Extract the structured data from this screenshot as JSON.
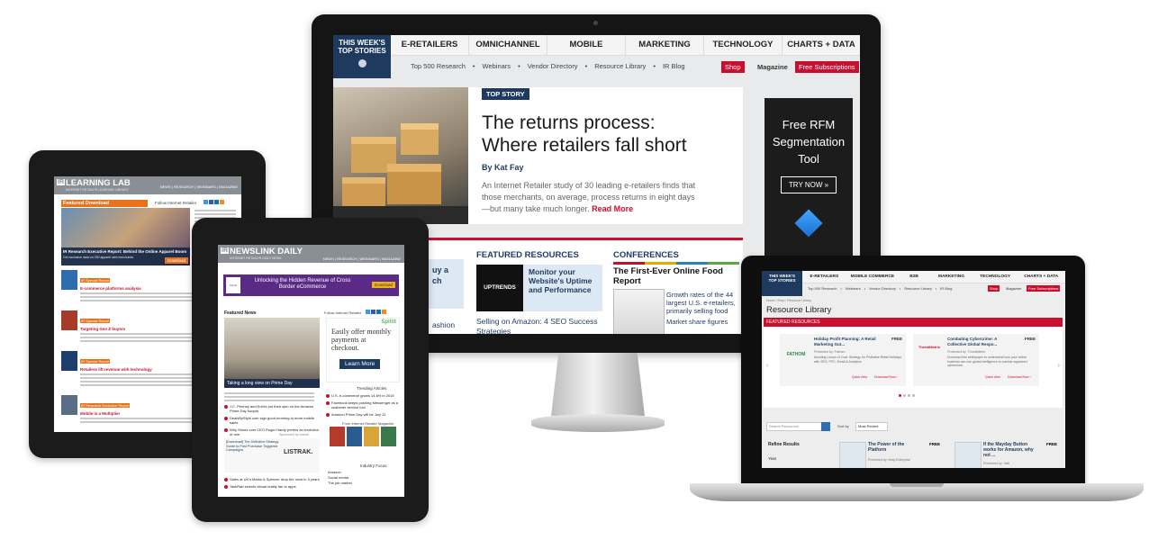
{
  "monitor": {
    "badge_line1": "THIS WEEK'S",
    "badge_line2": "TOP STORIES",
    "nav": [
      "E-RETAILERS",
      "OMNICHANNEL",
      "MOBILE",
      "MARKETING",
      "TECHNOLOGY",
      "CHARTS + DATA"
    ],
    "subnav": [
      "Top 500 Research",
      "Webinars",
      "Vendor Directory",
      "Resource Library",
      "IR Blog"
    ],
    "shop": "Shop",
    "magazine": "Magazine",
    "subscribe": "Free Subscriptions",
    "top_story_tag": "TOP STORY",
    "headline": "The returns process: Where retailers fall short",
    "byline": "By Kat Fay",
    "summary": "An Internet Retailer study of 30 leading e-retailers finds that those merchants, on average, process returns in eight days—but many take much longer.",
    "read_more": "Read More",
    "ad_lines": [
      "Free RFM",
      "Segmentation",
      "Tool"
    ],
    "ad_button": "TRY NOW »",
    "featured_title": "FEATURED RESOURCES",
    "uptrends_logo": "UPTRENDS",
    "featured_item": "Monitor your Website's Uptime and Performance",
    "featured_link": "Selling on Amazon: 4 SEO Success Strategies",
    "left_partial": [
      "uy a",
      "ch",
      "ashion"
    ],
    "conferences_title": "CONFERENCES",
    "conf_headline": "The First-Ever Online Food Report",
    "conf_bullets": [
      "Growth rates of the 44 largest U.S. e-retailers, primarily selling food",
      "Market share figures"
    ]
  },
  "tablet1": {
    "logo_ir": "IR",
    "logo_title": "LEARNING LAB",
    "logo_sub": "INTERNET RETAILER LEARNING LIBRARY",
    "nav": "NEWS | RESEARCH | WEBINARS | MAGAZINE",
    "follow": "Follow Internet Retailer",
    "featured_download": "Featured Download",
    "hero_caption": "IR Research Executive Report: Behind the Online Apparel Boom",
    "hero_sub": "Get exclusive data on 250 apparel web merchants.",
    "download": "Download",
    "items": [
      {
        "tag": "IR Special Report",
        "title": "E-commerce platforms analysis"
      },
      {
        "tag": "IR Special Report",
        "title": "Targeting Gen Z buyers"
      },
      {
        "tag": "IR Special Report",
        "title": "Retailers lift revenue with technology"
      },
      {
        "tag": "IR Research Exclusive Report",
        "title": "Mobile is a Multiplier"
      }
    ]
  },
  "tablet2": {
    "logo_ir": "IR",
    "logo_title": "NEWSLINK DAILY",
    "logo_sub": "INTERNET RETAILER DAILY NEWS",
    "nav": "NEWS | RESEARCH | WEBINARS | MAGAZINE",
    "banner_brand": "Flexiti",
    "banner_text": "Unlocking the Hidden Revenue of Cross Border eCommerce",
    "banner_btn": "Download",
    "featured_news": "Featured News",
    "follow": "Follow Internet Retailer",
    "photo_caption": "Taking a long view on Prime Day",
    "headlines": [
      "J.C. Penney and Kohl's put their spin on the Amazon Prime Day hoopla",
      "DealsByStyle.com sign good morning to more mobile sales",
      "Why Shoes.com CEO Roger Hardy prefers an evolution of one"
    ],
    "trending": "Trending Articles",
    "trending_items": [
      "U.S. e-commerce grows 14.6% in 2015",
      "Facebook keeps pushing Messenger as a customer service tool",
      "Amazon Prime Day will be July 12"
    ],
    "sponsored": "Sponsored by Listrak",
    "sponsored_title": "[Download] The Definitive Strategy Guide to Post Purchase Triggered Campaigns",
    "listrak": "LISTRAK.",
    "split_logo": "Splitit",
    "split_ad": "Easily offer monthly payments at checkout.",
    "learn_more": "Learn More",
    "magazine_title": "From Internet Retailer Magazine",
    "industry_focus": "Industry Focus",
    "focus_items": [
      "Amazon",
      "Social media",
      "The job market"
    ],
    "bottom_items": [
      "Sales at UK's Marks & Spencer drop the most in 3 years",
      "TaskRab selects virtual reality fan to apps"
    ]
  },
  "laptop": {
    "badge_line1": "THIS WEEK'S",
    "badge_line2": "TOP STORIES",
    "nav": [
      "E-RETAILERS",
      "MOBILE COMMERCE",
      "B2B",
      "MARKETING",
      "TECHNOLOGY",
      "CHARTS + DATA"
    ],
    "subnav": [
      "Top 500 Research",
      "Webinars",
      "Vendor Directory",
      "Resource Library",
      "IR Blog"
    ],
    "shop": "Shop",
    "magazine": "Magazine",
    "subscribe": "Free Subscriptions",
    "breadcrumb": "Home / Shop / Resource Library",
    "page_title": "Resource Library",
    "featured_bar": "FEATURED RESOURCES",
    "cards": [
      {
        "logo": "FATHOM",
        "title": "Holiday Profit Planning: A Retail Marketing Gut...",
        "badge": "FREE",
        "presented": "Presented by: Fathom",
        "desc": "Avoiding Lumps of Coal: Strategy for Profitable Retail Holidays with SEO, PPC, Email & Analytics",
        "quick": "Quick view",
        "download": "Download Now ›"
      },
      {
        "logo": "ThreatMetrix",
        "title": "Combating Cybercrime: A Collective Global Respo...",
        "badge": "FREE",
        "presented": "Presented by: ThreatMetrix",
        "desc": "Download this whitepaper to understand how your online business can use global intelligence to combat organized cybercrime.",
        "quick": "Quick view",
        "download": "Download Now ›"
      }
    ],
    "search_placeholder": "Search Resources",
    "sort_by": "Sort by",
    "sort_value": "Most Recent",
    "refine": "Refine Results",
    "year": "Year",
    "results": [
      {
        "title": "The Power of the Platform",
        "badge": "FREE",
        "presented": "Presented by: ebay Enterprise"
      },
      {
        "title": "If the Mayday Button works for Amazon, why not ...",
        "badge": "FREE",
        "presented": "Presented by: Velti"
      }
    ]
  }
}
